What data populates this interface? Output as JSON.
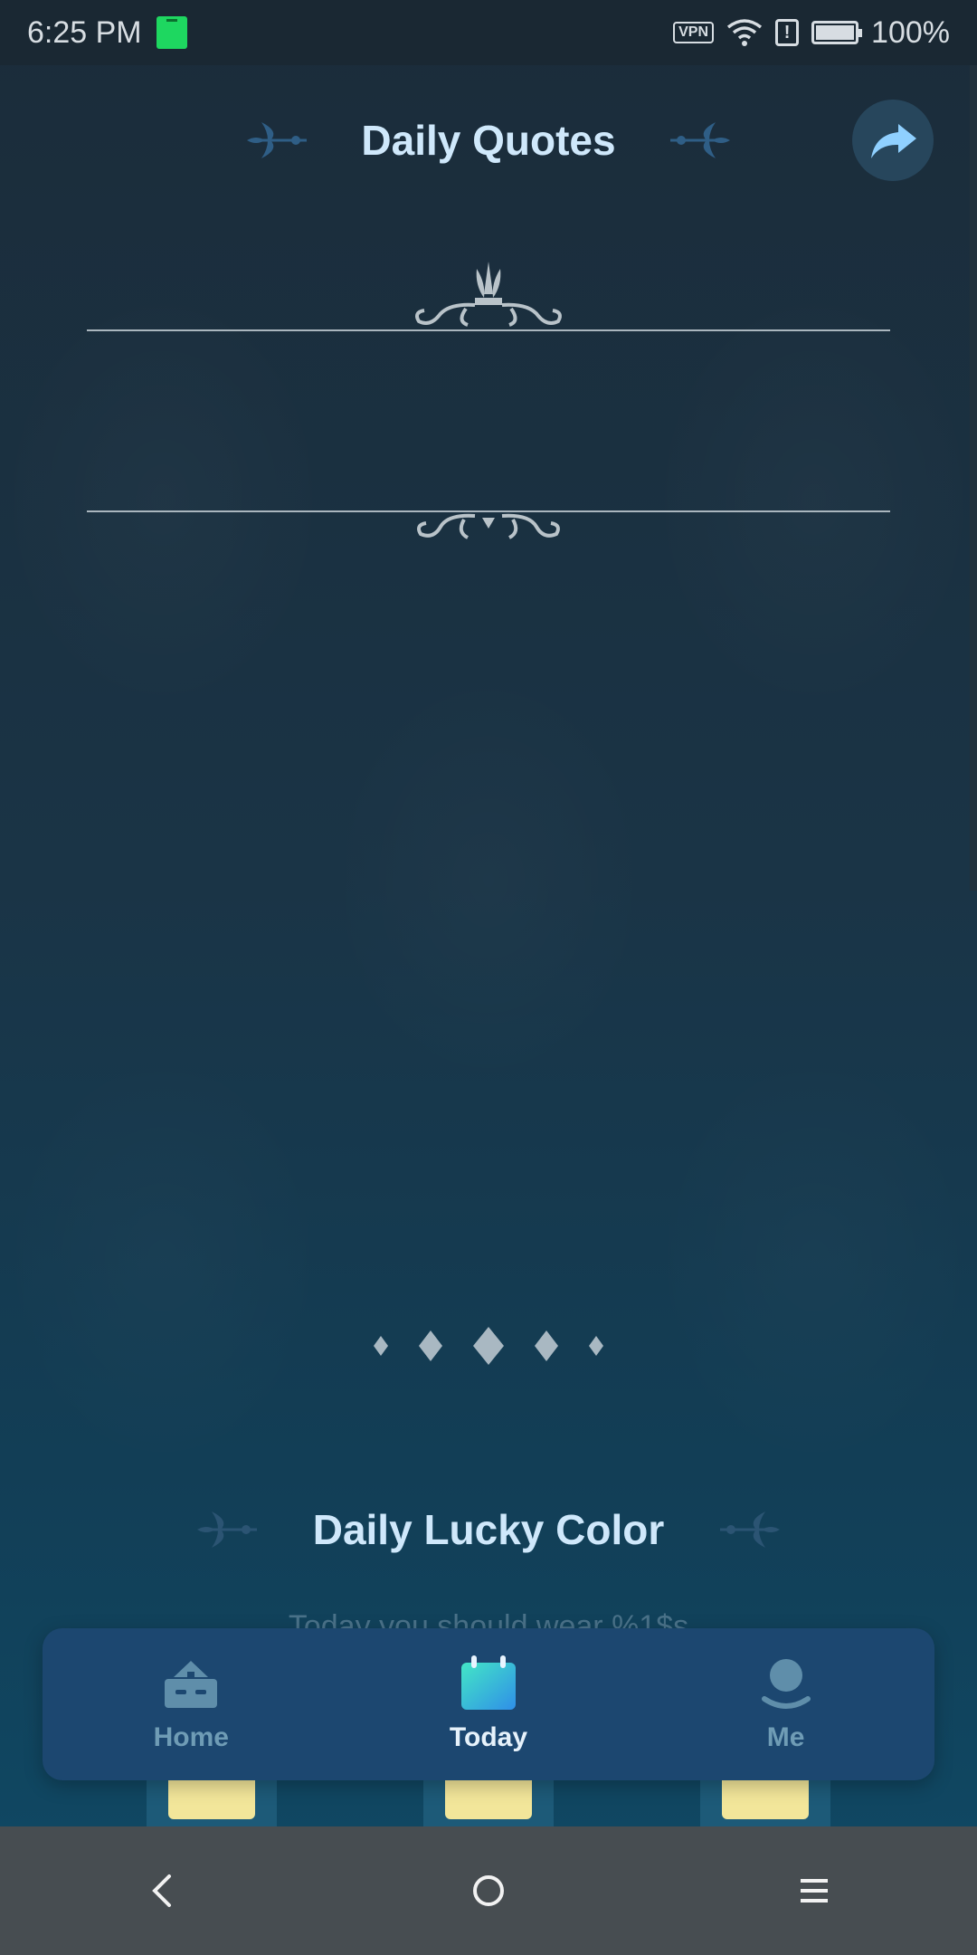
{
  "status_bar": {
    "time": "6:25 PM",
    "vpn_label": "VPN",
    "alert_symbol": "!",
    "battery": "100%",
    "icons": [
      "notification-icon",
      "vpn-icon",
      "wifi-icon",
      "alert-icon",
      "battery-icon"
    ]
  },
  "header": {
    "title": "Daily Quotes",
    "share_icon": "share-arrow-icon"
  },
  "quote": {
    "text": ""
  },
  "lucky_color": {
    "title": "Daily Lucky Color",
    "text": "Today you should wear %1$s"
  },
  "tabs": [
    {
      "label": "Home",
      "icon": "home-icon",
      "active": false
    },
    {
      "label": "Today",
      "icon": "calendar-icon",
      "active": true
    },
    {
      "label": "Me",
      "icon": "profile-icon",
      "active": false
    }
  ],
  "nav": {
    "back": "back-icon",
    "home": "home-circle-icon",
    "menu": "menu-icon"
  },
  "colors": {
    "accent": "#cfe8fb",
    "tab_bar": "#1c4770",
    "swatch": "#f2e69a"
  }
}
